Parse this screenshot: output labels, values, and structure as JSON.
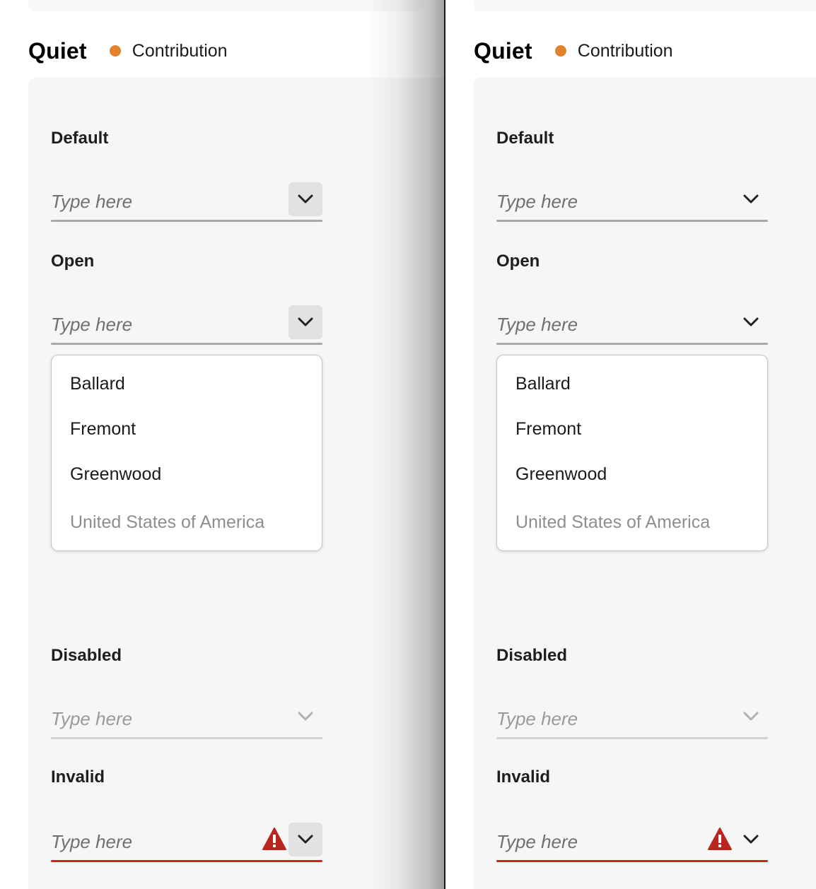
{
  "colors": {
    "contribution_dot": "#e3822d",
    "invalid": "#c9251d",
    "alert_icon": "#b8261e"
  },
  "panels": [
    {
      "id": "left",
      "variant_title": "Quiet",
      "tag": "Contribution",
      "chevron_style": "boxed",
      "fields": {
        "default": {
          "label": "Default",
          "placeholder": "Type here"
        },
        "open": {
          "label": "Open",
          "placeholder": "Type here"
        },
        "disabled": {
          "label": "Disabled",
          "placeholder": "Type here"
        },
        "invalid": {
          "label": "Invalid",
          "placeholder": "Type here"
        }
      },
      "menu_items": [
        "Ballard",
        "Fremont",
        "Greenwood",
        "United States of America"
      ]
    },
    {
      "id": "right",
      "variant_title": "Quiet",
      "tag": "Contribution",
      "chevron_style": "plain",
      "fields": {
        "default": {
          "label": "Default",
          "placeholder": "Type here"
        },
        "open": {
          "label": "Open",
          "placeholder": "Type here"
        },
        "disabled": {
          "label": "Disabled",
          "placeholder": "Type here"
        },
        "invalid": {
          "label": "Invalid",
          "placeholder": "Type here"
        }
      },
      "menu_items": [
        "Ballard",
        "Fremont",
        "Greenwood",
        "United States of America"
      ]
    }
  ]
}
